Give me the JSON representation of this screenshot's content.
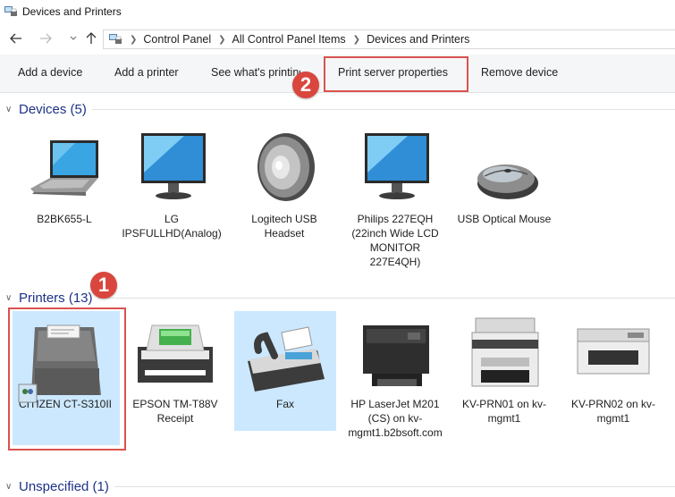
{
  "window": {
    "title": "Devices and Printers",
    "icon": "devices-printers-icon"
  },
  "nav": {
    "back_icon": "arrow-left-icon",
    "forward_icon": "arrow-right-icon",
    "recent_icon": "chevron-down-icon",
    "up_icon": "arrow-up-icon",
    "breadcrumb": [
      "Control Panel",
      "All Control Panel Items",
      "Devices and Printers"
    ]
  },
  "toolbar": {
    "add_device": "Add a device",
    "add_printer": "Add a printer",
    "see_whats_printing": "See what's printing",
    "print_server_properties": "Print server properties",
    "remove_device": "Remove device"
  },
  "callouts": {
    "one": "1",
    "two": "2"
  },
  "groups": {
    "devices": {
      "label": "Devices (5)",
      "items": [
        {
          "label": "B2BK655-L",
          "icon": "laptop-icon"
        },
        {
          "label": "LG IPSFULLHD(Analog)",
          "icon": "monitor-icon"
        },
        {
          "label": "Logitech USB Headset",
          "icon": "speaker-icon"
        },
        {
          "label": "Philips 227EQH (22inch Wide LCD MONITOR 227E4QH)",
          "icon": "monitor-icon"
        },
        {
          "label": "USB Optical Mouse",
          "icon": "mouse-icon"
        }
      ]
    },
    "printers": {
      "label": "Printers (13)",
      "items": [
        {
          "label": "CITIZEN CT-S310II",
          "icon": "receipt-printer-icon",
          "selected": true
        },
        {
          "label": "EPSON TM-T88V Receipt",
          "icon": "printer-icon"
        },
        {
          "label": "Fax",
          "icon": "fax-icon"
        },
        {
          "label": "HP LaserJet M201 (CS) on kv-mgmt1.b2bsoft.com",
          "icon": "laser-printer-icon"
        },
        {
          "label": "KV-PRN01 on kv-mgmt1",
          "icon": "mfp-printer-icon"
        },
        {
          "label": "KV-PRN02 on kv-mgmt1",
          "icon": "laser-printer-icon"
        }
      ]
    },
    "unspecified": {
      "label": "Unspecified (1)"
    }
  },
  "colors": {
    "accent": "#1e3287",
    "highlight": "#d9534f",
    "selection": "#cce8ff"
  }
}
